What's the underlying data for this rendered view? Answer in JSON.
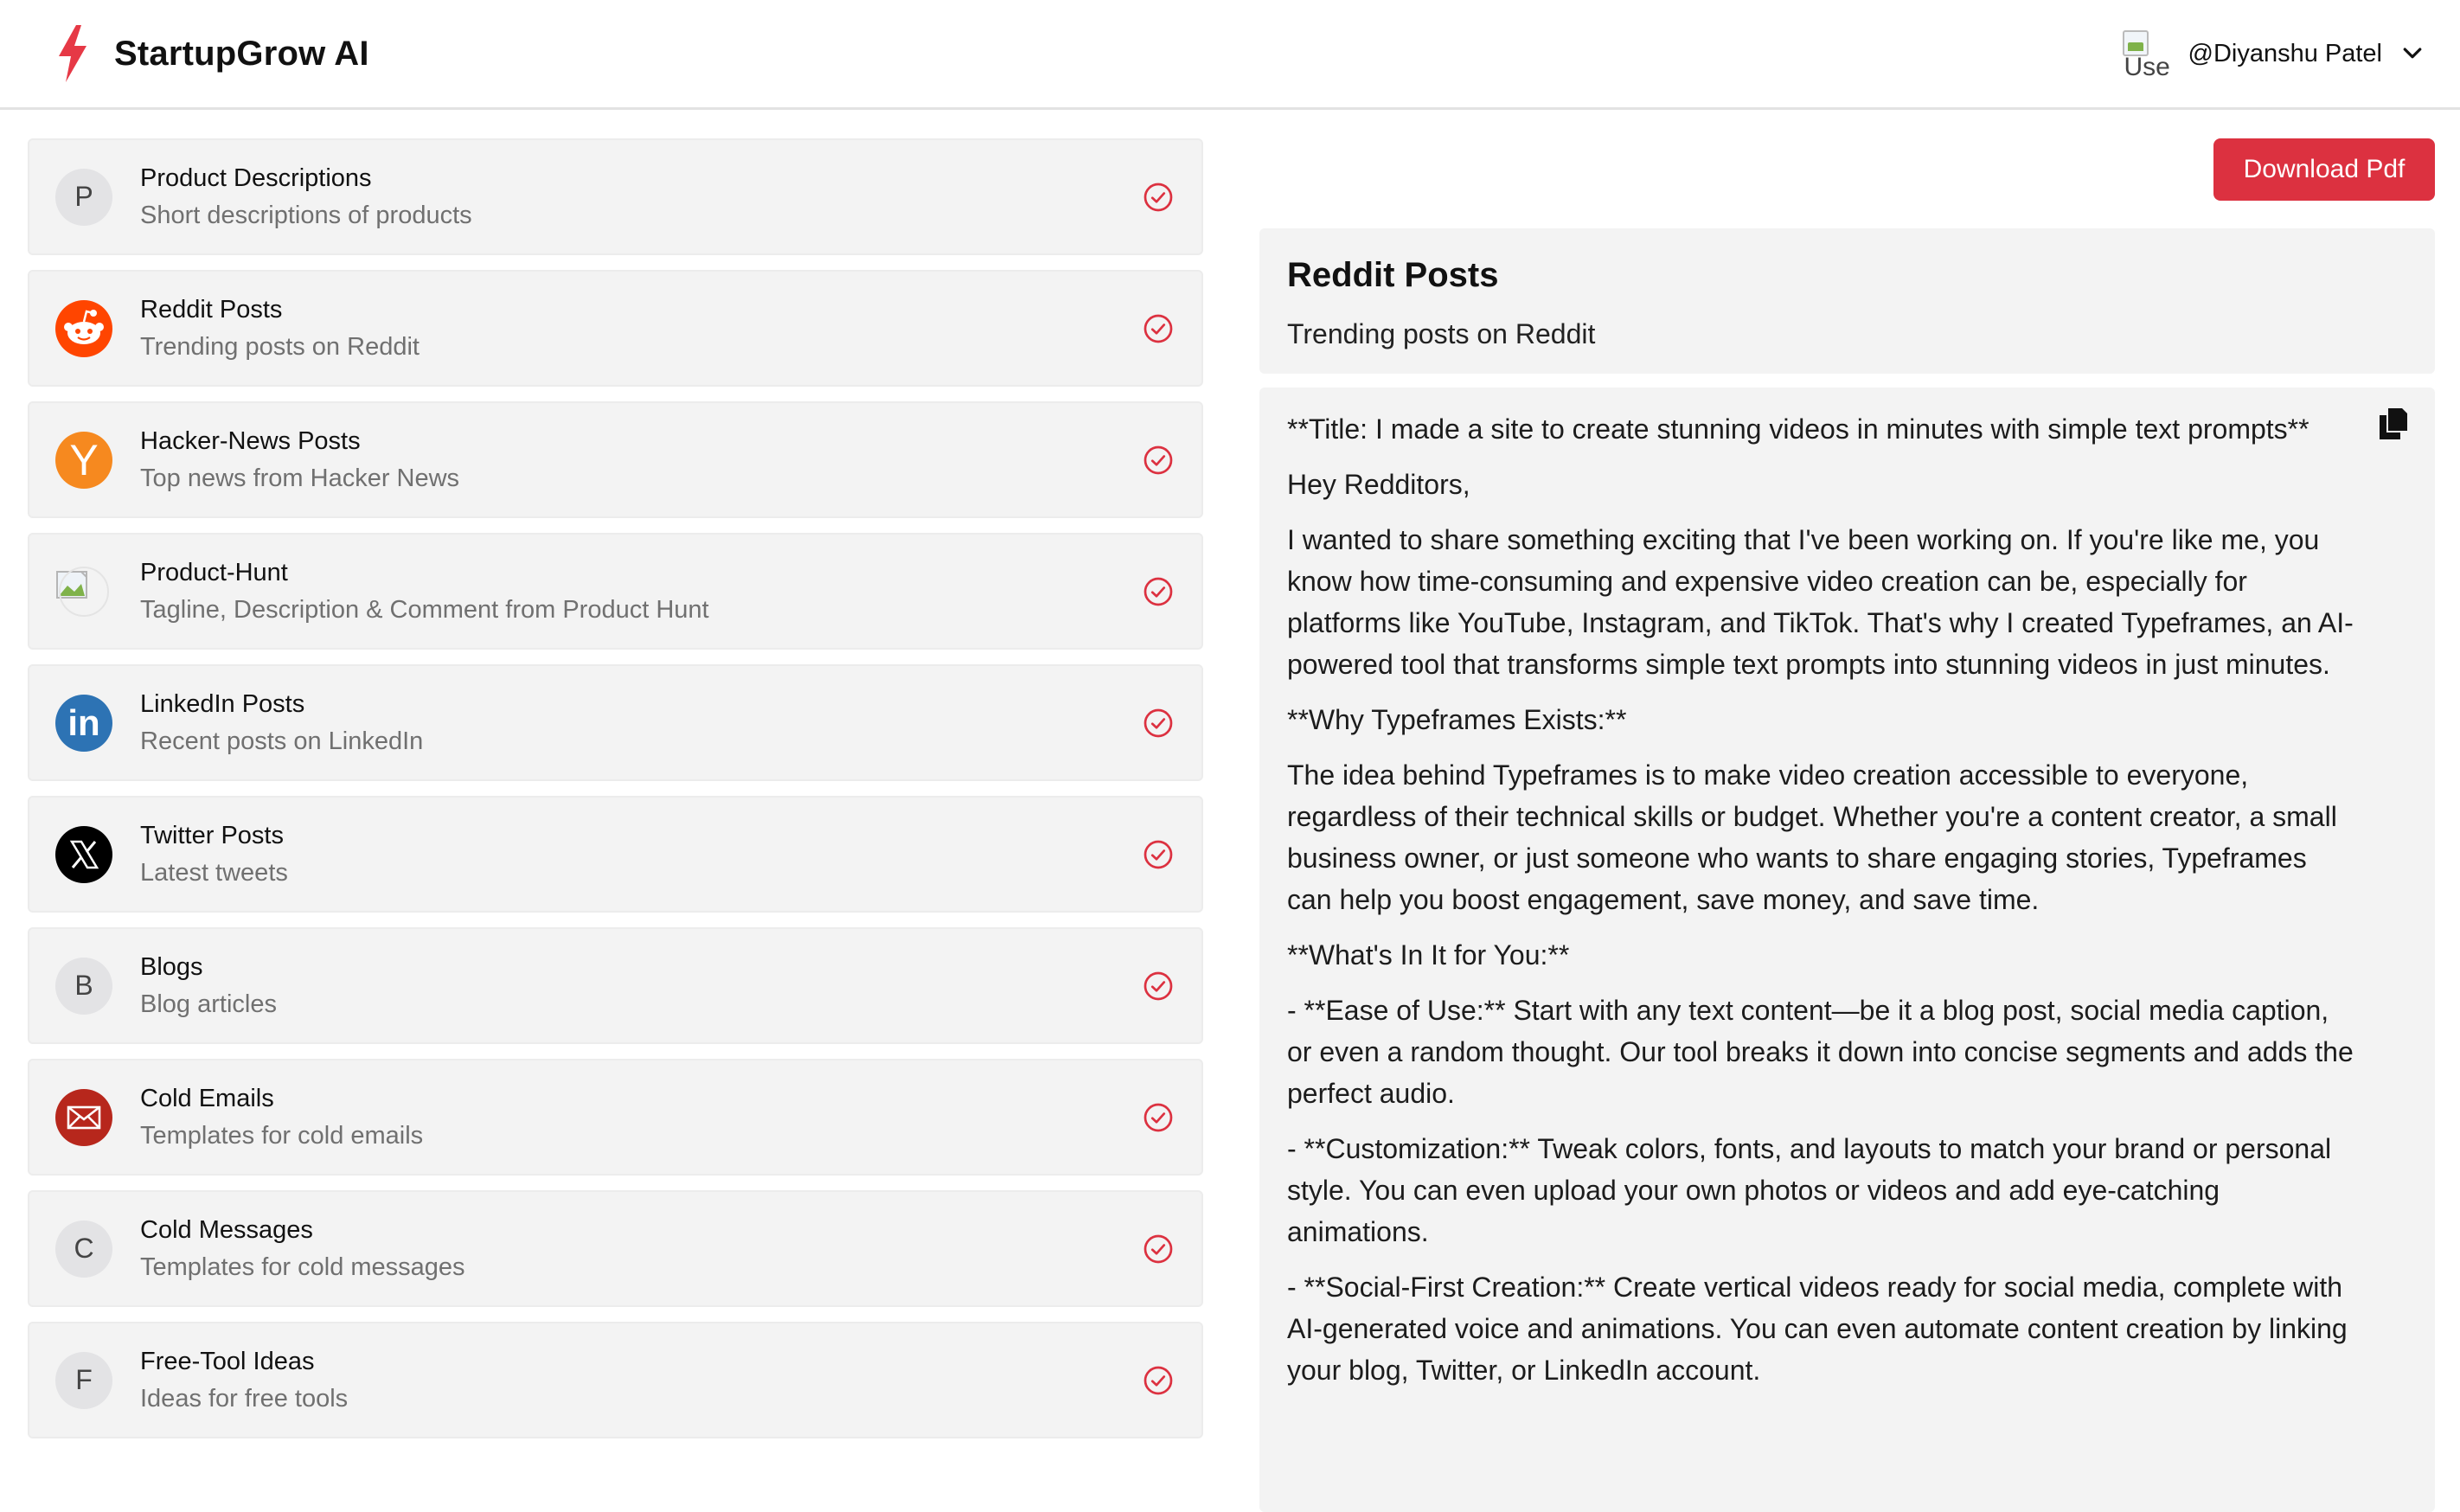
{
  "header": {
    "brand": "StartupGrow AI",
    "brand_color": "#e63946",
    "avatar_alt": "Use",
    "user_name": "@Diyanshu Patel"
  },
  "sidebar": {
    "items": [
      {
        "title": "Product Descriptions",
        "subtitle": "Short descriptions of products",
        "icon": "letter-p-icon",
        "letter": "P"
      },
      {
        "title": "Reddit Posts",
        "subtitle": "Trending posts on Reddit",
        "icon": "reddit-icon"
      },
      {
        "title": "Hacker-News Posts",
        "subtitle": "Top news from Hacker News",
        "icon": "hacker-news-icon",
        "letter": "Y"
      },
      {
        "title": "Product-Hunt",
        "subtitle": "Tagline, Description & Comment from Product Hunt",
        "icon": "broken-image-icon"
      },
      {
        "title": "LinkedIn Posts",
        "subtitle": "Recent posts on LinkedIn",
        "icon": "linkedin-icon",
        "letter": "in"
      },
      {
        "title": "Twitter Posts",
        "subtitle": "Latest tweets",
        "icon": "x-logo-icon"
      },
      {
        "title": "Blogs",
        "subtitle": "Blog articles",
        "icon": "letter-b-icon",
        "letter": "B"
      },
      {
        "title": "Cold Emails",
        "subtitle": "Templates for cold emails",
        "icon": "mail-icon"
      },
      {
        "title": "Cold Messages",
        "subtitle": "Templates for cold messages",
        "icon": "letter-c-icon",
        "letter": "C"
      },
      {
        "title": "Free-Tool Ideas",
        "subtitle": "Ideas for free tools",
        "icon": "letter-f-icon",
        "letter": "F"
      }
    ],
    "check_color": "#dc3140"
  },
  "main": {
    "download_label": "Download Pdf",
    "section_title": "Reddit Posts",
    "section_subtitle": "Trending posts on Reddit",
    "paragraphs": [
      "**Title: I made a site to create stunning videos in minutes with simple text prompts**",
      "Hey Redditors,",
      "I wanted to share something exciting that I've been working on. If you're like me, you know how time-consuming and expensive video creation can be, especially for platforms like YouTube, Instagram, and TikTok. That's why I created Typeframes, an AI-powered tool that transforms simple text prompts into stunning videos in just minutes.",
      "**Why Typeframes Exists:**",
      "The idea behind Typeframes is to make video creation accessible to everyone, regardless of their technical skills or budget. Whether you're a content creator, a small business owner, or just someone who wants to share engaging stories, Typeframes can help you boost engagement, save money, and save time.",
      "**What's In It for You:**",
      "- **Ease of Use:** Start with any text content—be it a blog post, social media caption, or even a random thought. Our tool breaks it down into concise segments and adds the perfect audio.",
      "- **Customization:** Tweak colors, fonts, and layouts to match your brand or personal style. You can even upload your own photos or videos and add eye-catching animations.",
      "- **Social-First Creation:** Create vertical videos ready for social media, complete with AI-generated voice and animations. You can even automate content creation by linking your blog, Twitter, or LinkedIn account."
    ]
  }
}
